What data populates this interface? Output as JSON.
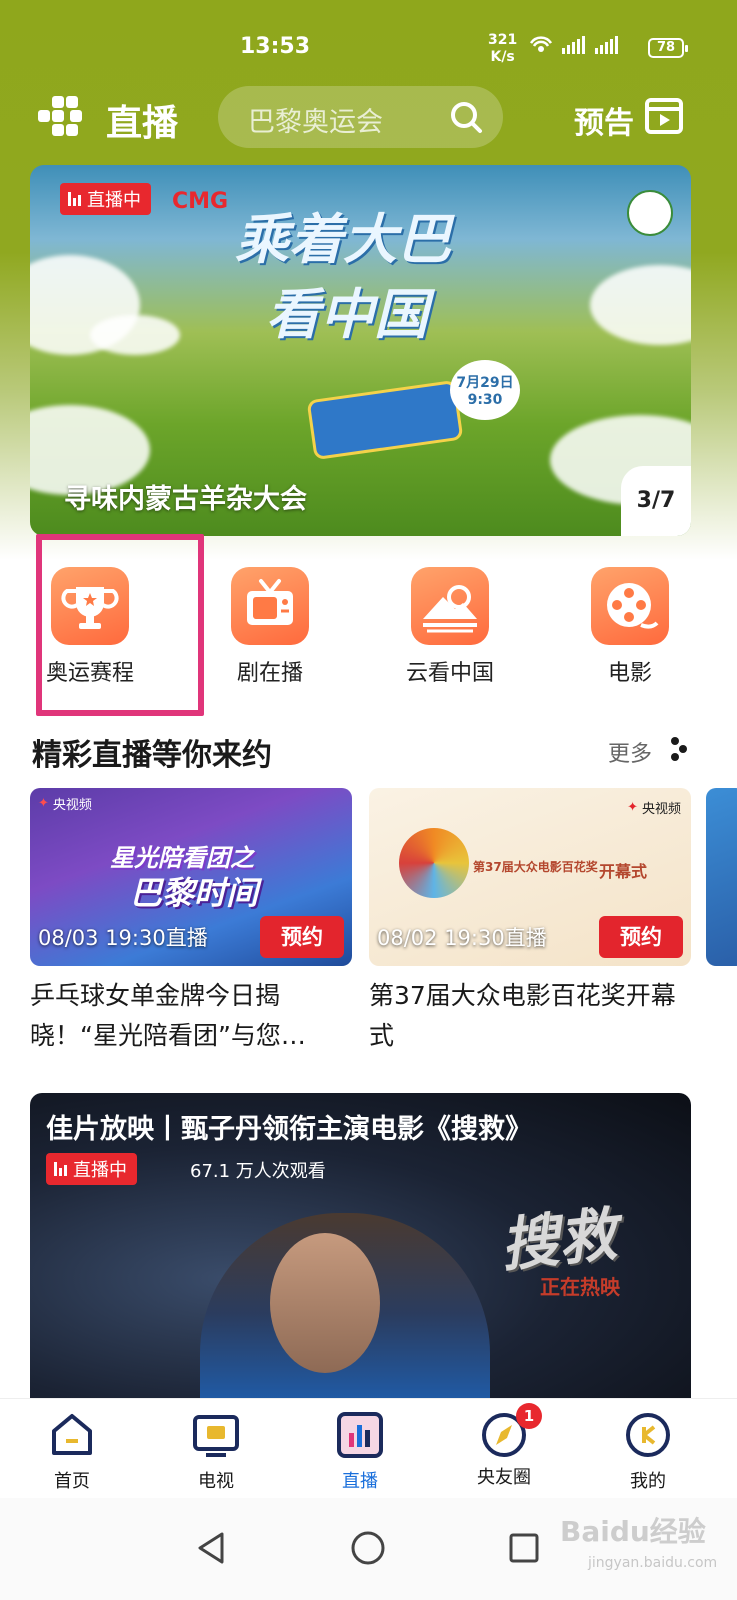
{
  "status_bar": {
    "time": "13:53",
    "speed_value": "321",
    "speed_unit": "K/s",
    "battery": "78"
  },
  "header": {
    "title": "直播",
    "search_placeholder": "巴黎奥运会",
    "preview_label": "预告"
  },
  "banner": {
    "live_label": "直播中",
    "brand": "CMG",
    "art_line1": "乘着大巴",
    "art_line2": "看中国",
    "bus_date": "7月29日 9:30",
    "caption": "寻味内蒙古羊杂大会",
    "counter": "3/7"
  },
  "categories": [
    {
      "label": "奥运赛程",
      "icon": "trophy-icon"
    },
    {
      "label": "剧在播",
      "icon": "tv-icon"
    },
    {
      "label": "云看中国",
      "icon": "mountain-icon"
    },
    {
      "label": "电影",
      "icon": "film-reel-icon"
    }
  ],
  "section": {
    "title": "精彩直播等你来约",
    "more": "更多"
  },
  "live_cards": [
    {
      "logo": "央视频",
      "thumb_line1": "星光陪看团之",
      "thumb_line2": "巴黎时间",
      "time": "08/03 19:30直播",
      "button": "预约",
      "title": "乒乓球女单金牌今日揭晓！“星光陪看团”与您…"
    },
    {
      "logo": "央视频",
      "award_line1": "第37届大众电影百花奖",
      "award_line2": "开幕式",
      "time": "08/02 19:30直播",
      "button": "预约",
      "title": "第37届大众电影百花奖开幕式"
    }
  ],
  "movie": {
    "title": "佳片放映丨甄子丹领衔主演电影《搜救》",
    "live_label": "直播中",
    "viewers": "67.1 万人次观看",
    "poster_title": "搜救",
    "poster_sub": "正在热映"
  },
  "bottom_nav": [
    {
      "label": "首页",
      "icon": "home-icon"
    },
    {
      "label": "电视",
      "icon": "tv-screen-icon"
    },
    {
      "label": "直播",
      "icon": "live-chart-icon",
      "active": true
    },
    {
      "label": "央友圈",
      "icon": "compass-icon",
      "badge": "1"
    },
    {
      "label": "我的",
      "icon": "profile-icon"
    }
  ],
  "watermark": {
    "main": "Baidu经验",
    "sub": "jingyan.baidu.com"
  },
  "colors": {
    "header_green": "#8fa71c",
    "accent_red": "#e3252d",
    "highlight_pink": "#e0357a",
    "active_blue": "#1a6fdb"
  }
}
